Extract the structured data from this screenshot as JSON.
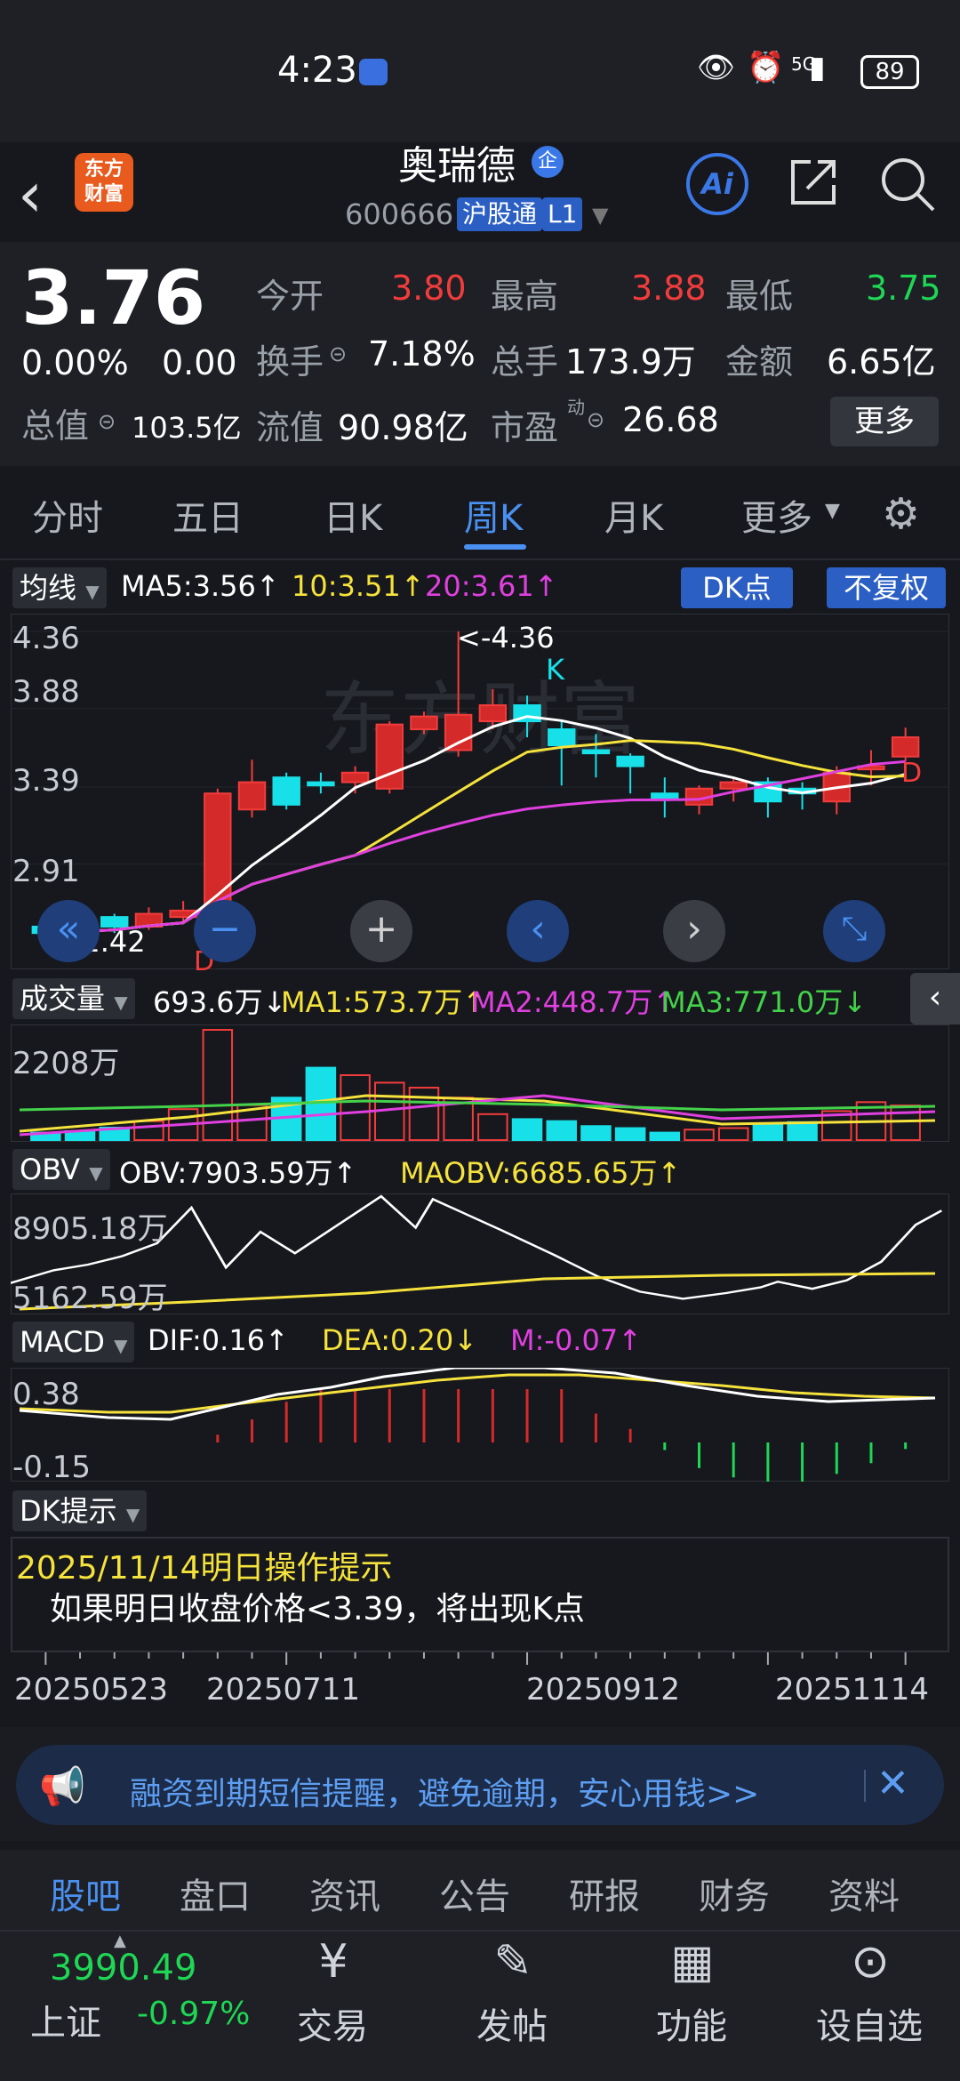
{
  "status": {
    "time": "4:23",
    "battery": "89",
    "network": "5G"
  },
  "header": {
    "logo_text": "东方\n财富",
    "name": "奥瑞德",
    "badge": "企",
    "code": "600666",
    "exchange_badge": "沪股通",
    "level_badge": "L1",
    "ai_label": "Ai"
  },
  "quote": {
    "price": "3.76",
    "change_pct": "0.00%",
    "change_val": "0.00",
    "mktcap_label": "总值",
    "mktcap_value": "103.5亿",
    "open_label": "今开",
    "open_value": "3.80",
    "high_label": "最高",
    "high_value": "3.88",
    "low_label": "最低",
    "low_value": "3.75",
    "turnover_label": "换手",
    "turnover_value": "7.18%",
    "volume_label": "总手",
    "volume_value": "173.9万",
    "amount_label": "金额",
    "amount_value": "6.65亿",
    "float_label": "流值",
    "float_value": "90.98亿",
    "pe_label": "市盈",
    "pe_sup": "动",
    "pe_value": "26.68",
    "more_label": "更多"
  },
  "tabs": [
    "分时",
    "五日",
    "日K",
    "周K",
    "月K",
    "更多"
  ],
  "active_tab": "周K",
  "kline": {
    "indicator": "均线",
    "ma5": "MA5:3.56↑",
    "ma10": "10:3.51↑",
    "ma20": "20:3.61↑",
    "dk_label": "DK点",
    "adjust_label": "不复权",
    "y_labels": [
      "4.36",
      "3.88",
      "3.39",
      "2.91"
    ],
    "high_marker": "<-4.36",
    "low_marker": "<-2.42",
    "k_marker": "K",
    "d_marker": "D",
    "watermark": "东方财富"
  },
  "volume": {
    "indicator": "成交量",
    "value": "693.6万↓",
    "ma1": "MA1:573.7万↑",
    "ma2": "MA2:448.7万↑",
    "ma3": "MA3:771.0万↓",
    "y_label": "2208万"
  },
  "obv": {
    "indicator": "OBV",
    "value": "OBV:7903.59万↑",
    "maobv": "MAOBV:6685.65万↑",
    "y_top": "8905.18万",
    "y_bottom": "5162.59万"
  },
  "macd": {
    "indicator": "MACD",
    "dif": "DIF:0.16↑",
    "dea": "DEA:0.20↓",
    "m": "M:-0.07↑",
    "y_top": "0.38",
    "y_bottom": "-0.15"
  },
  "dk_tip": {
    "indicator": "DK提示",
    "date_line": "2025/11/14明日操作提示",
    "message": "如果明日收盘价格<3.39，将出现K点"
  },
  "x_dates": [
    "20250523",
    "20250711",
    "20250912",
    "20251114"
  ],
  "banner": {
    "text": "融资到期短信提醒，避免逾期，安心用钱>>"
  },
  "bottom_tabs": [
    "股吧",
    "盘口",
    "资讯",
    "公告",
    "研报",
    "财务",
    "资料"
  ],
  "footer": {
    "index_value": "3990.49",
    "index_name": "上证",
    "index_change": "-0.97%",
    "buttons": [
      "交易",
      "发帖",
      "功能",
      "设自选"
    ]
  },
  "colors": {
    "up": "#f23c3c",
    "down": "#18e0e8",
    "accent": "#4a90f0"
  },
  "chart_data": {
    "type": "candlestick",
    "x": [
      "20250523",
      "",
      "",
      "",
      "",
      "",
      "20250711",
      "",
      "",
      "",
      "",
      "",
      "",
      "",
      "",
      "20250912",
      "",
      "",
      "",
      "",
      "",
      "",
      "",
      "",
      "",
      "20251114"
    ],
    "open": [
      2.52,
      2.55,
      2.58,
      2.52,
      2.58,
      2.62,
      3.25,
      3.45,
      3.42,
      3.42,
      3.38,
      3.75,
      3.62,
      3.8,
      3.9,
      3.75,
      3.62,
      3.58,
      3.35,
      3.28,
      3.38,
      3.42,
      3.38,
      3.3,
      3.5,
      3.58
    ],
    "close": [
      2.48,
      2.5,
      2.52,
      2.6,
      2.62,
      3.35,
      3.42,
      3.28,
      3.4,
      3.48,
      3.78,
      3.83,
      3.84,
      3.9,
      3.8,
      3.65,
      3.6,
      3.52,
      3.32,
      3.38,
      3.42,
      3.3,
      3.35,
      3.48,
      3.52,
      3.7
    ],
    "high": [
      2.58,
      2.6,
      2.6,
      2.64,
      2.68,
      3.38,
      3.56,
      3.48,
      3.48,
      3.52,
      3.8,
      3.86,
      4.36,
      4.0,
      3.96,
      3.8,
      3.72,
      3.6,
      3.45,
      3.4,
      3.45,
      3.45,
      3.42,
      3.52,
      3.62,
      3.76
    ],
    "low": [
      2.42,
      2.45,
      2.48,
      2.5,
      2.55,
      2.6,
      3.2,
      3.25,
      3.35,
      3.35,
      3.35,
      3.72,
      3.58,
      3.75,
      3.7,
      3.4,
      3.45,
      3.35,
      3.2,
      3.22,
      3.3,
      3.2,
      3.25,
      3.22,
      3.4,
      3.55
    ],
    "ylim": [
      2.42,
      4.36
    ],
    "volume": [
      150,
      180,
      250,
      380,
      620,
      2208,
      700,
      850,
      1450,
      1300,
      1150,
      1050,
      850,
      520,
      420,
      380,
      280,
      240,
      150,
      210,
      240,
      320,
      360,
      580,
      760,
      693.6
    ]
  }
}
